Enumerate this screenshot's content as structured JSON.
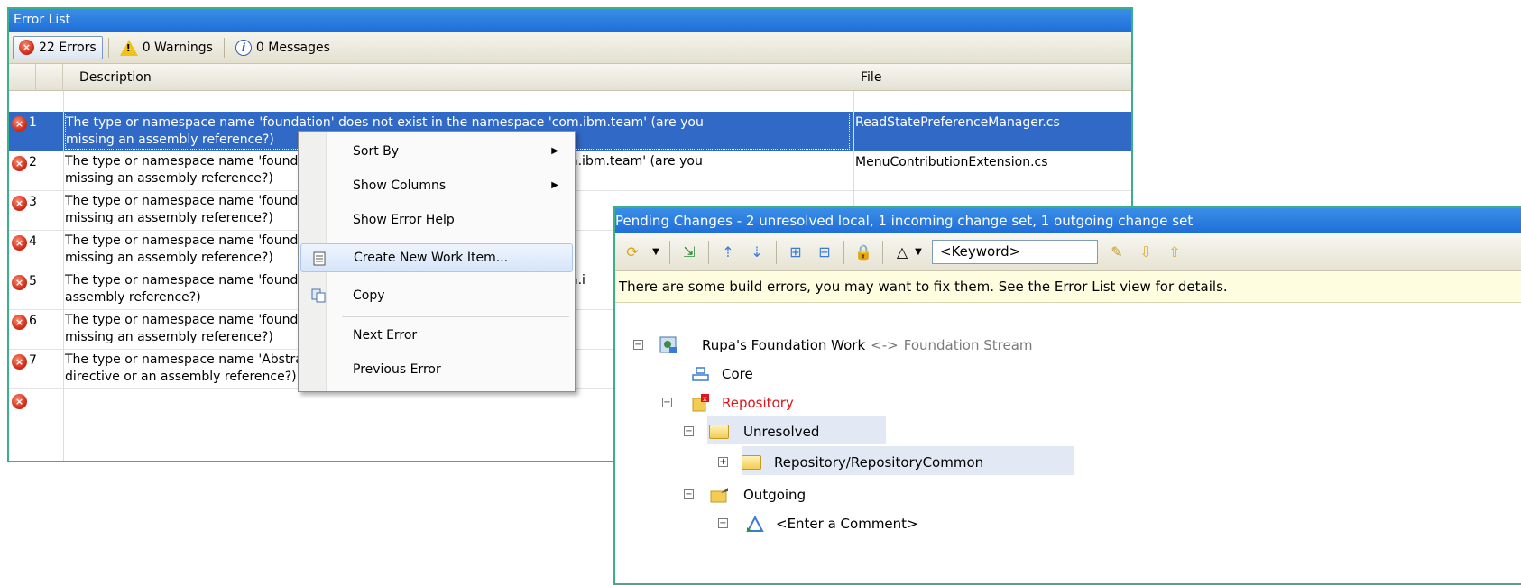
{
  "error_list": {
    "title": "Error List",
    "filters": {
      "errors": "22 Errors",
      "warnings": "0 Warnings",
      "messages": "0 Messages"
    },
    "columns": {
      "description": "Description",
      "file": "File"
    },
    "rows": [
      {
        "num": "1",
        "desc": "The type or namespace name 'foundation' does not exist in the namespace 'com.ibm.team' (are you",
        "desc2": "missing an assembly reference?)",
        "file": "ReadStatePreferenceManager.cs"
      },
      {
        "num": "2",
        "desc": "The type or namespace name 'foundation' does not exist in the namespace 'com.ibm.team' (are you",
        "desc2": "missing an assembly reference?)",
        "file": "MenuContributionExtension.cs"
      },
      {
        "num": "3",
        "desc": "The type or namespace name 'foundation' does not exist in the namespace",
        "desc2": "missing an assembly reference?)",
        "file": ""
      },
      {
        "num": "4",
        "desc": "The type or namespace name 'foundation' does not exist in the namespace",
        "desc2": "missing an assembly reference?)",
        "file": ""
      },
      {
        "num": "5",
        "desc": "The type or namespace name 'foundation' does not exist in the namespace 'com.i",
        "desc2": "assembly reference?)",
        "file": ""
      },
      {
        "num": "6",
        "desc": "The type or namespace name 'foundation' does not exist in the namespace",
        "desc2": "missing an assembly reference?)",
        "file": ""
      },
      {
        "num": "7",
        "desc": "The type or namespace name 'AbstractPersistenceManager' could not be f",
        "desc2": "directive or an assembly reference?)",
        "file": ""
      }
    ]
  },
  "context_menu": {
    "items": {
      "sort_by": "Sort By",
      "show_columns": "Show Columns",
      "show_error_help": "Show Error Help",
      "create_work_item": "Create New Work Item...",
      "copy": "Copy",
      "next_error": "Next Error",
      "previous_error": "Previous Error"
    }
  },
  "pending_changes": {
    "title": "Pending Changes - 2 unresolved local, 1 incoming change set, 1 outgoing change set",
    "keyword_placeholder": "<Keyword>",
    "banner": "There are some build errors, you may want to fix them. See the Error List view for details.",
    "tree": {
      "workspace": "Rupa's Foundation Work",
      "arrow": "<->",
      "stream": "Foundation Stream",
      "core": "Core",
      "repository": "Repository",
      "unresolved": "Unresolved",
      "repo_common": "Repository/RepositoryCommon",
      "outgoing": "Outgoing",
      "comment": "<Enter a Comment>"
    }
  },
  "colors": {
    "selection": "#3169c6",
    "titlebar": "#1f6ed8",
    "repository_text": "#e0141a",
    "window_border": "#3ab08a"
  }
}
